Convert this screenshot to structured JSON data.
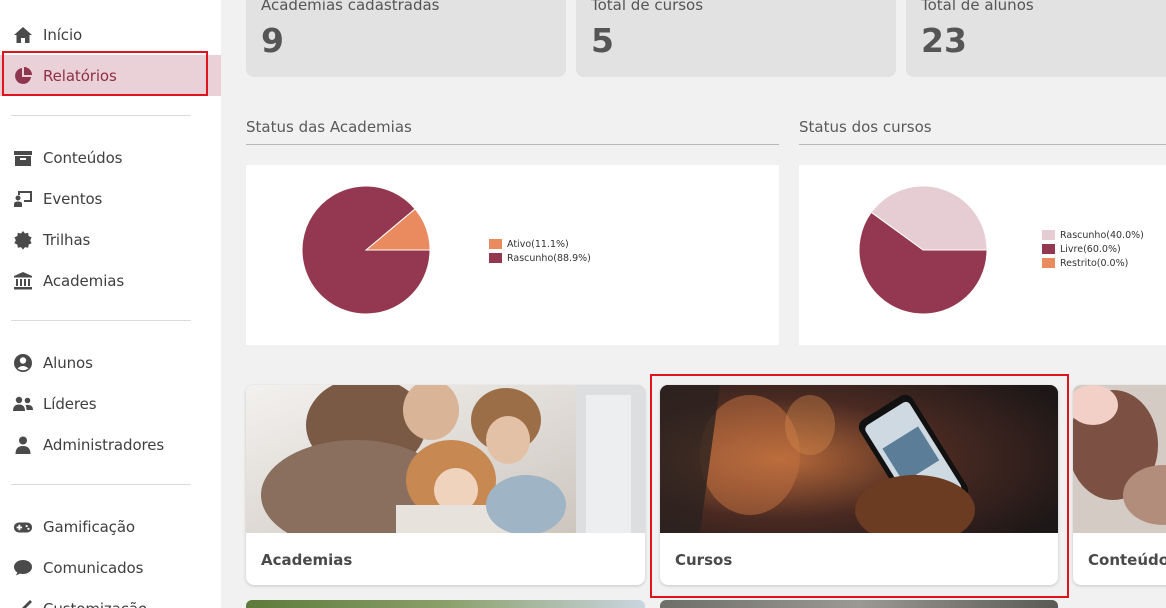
{
  "sidebar": {
    "items": [
      {
        "label": "Início",
        "icon": "home-icon"
      },
      {
        "label": "Relatórios",
        "icon": "pie-chart-icon",
        "active": true
      },
      {
        "label": "Conteúdos",
        "icon": "archive-box-icon"
      },
      {
        "label": "Eventos",
        "icon": "presentation-icon"
      },
      {
        "label": "Trilhas",
        "icon": "gear-badge-icon"
      },
      {
        "label": "Academias",
        "icon": "institution-icon"
      },
      {
        "label": "Alunos",
        "icon": "user-circle-icon"
      },
      {
        "label": "Líderes",
        "icon": "users-icon"
      },
      {
        "label": "Administradores",
        "icon": "user-admin-icon"
      },
      {
        "label": "Gamificação",
        "icon": "gamepad-icon"
      },
      {
        "label": "Comunicados",
        "icon": "chat-bubble-icon"
      },
      {
        "label": "Customização",
        "icon": "brush-icon"
      }
    ]
  },
  "stats": [
    {
      "label": "Academias cadastradas",
      "value": "9"
    },
    {
      "label": "Total de cursos",
      "value": "5"
    },
    {
      "label": "Total de alunos",
      "value": "23"
    }
  ],
  "charts": {
    "academias_title": "Status das Academias",
    "cursos_title": "Status dos cursos"
  },
  "chart_data": [
    {
      "type": "pie",
      "title": "Status das Academias",
      "legend_placement": "right",
      "series": [
        {
          "name": "Ativo",
          "value": 11.1,
          "label": "Ativo(11.1%)",
          "color": "#e98a5f"
        },
        {
          "name": "Rascunho",
          "value": 88.9,
          "label": "Rascunho(88.9%)",
          "color": "#933850"
        }
      ]
    },
    {
      "type": "pie",
      "title": "Status dos cursos",
      "legend_placement": "right",
      "series": [
        {
          "name": "Rascunho",
          "value": 40.0,
          "label": "Rascunho(40.0%)",
          "color": "#e6cdd3"
        },
        {
          "name": "Livre",
          "value": 60.0,
          "label": "Livre(60.0%)",
          "color": "#933850"
        },
        {
          "name": "Restrito",
          "value": 0.0,
          "label": "Restrito(0.0%)",
          "color": "#e98a5f"
        }
      ]
    }
  ],
  "cards": [
    {
      "label": "Academias"
    },
    {
      "label": "Cursos"
    },
    {
      "label": "Conteúdos"
    }
  ],
  "colors": {
    "accent": "#933850",
    "active_bg": "#ead1d8",
    "highlight": "#e0141d"
  }
}
